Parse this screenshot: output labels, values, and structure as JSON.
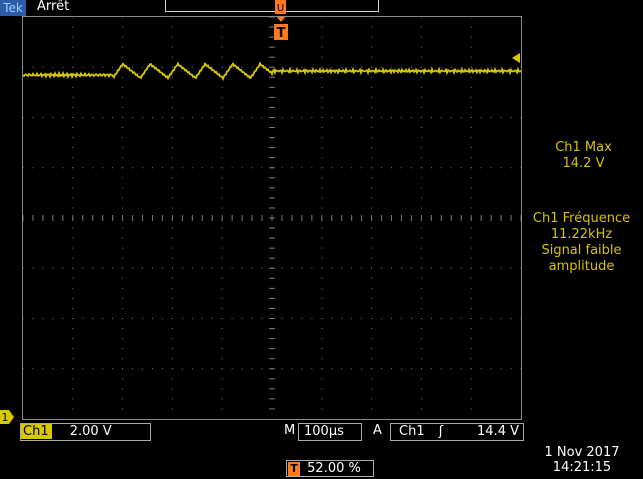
{
  "header": {
    "brand": "Tek",
    "acquisition_state": "Arrêt"
  },
  "measurements": {
    "max_label": "Ch1 Max",
    "max_value": "14.2 V",
    "freq_label": "Ch1 Fréquence",
    "freq_value": "11.22kHz",
    "freq_note_1": "Signal faible",
    "freq_note_2": "amplitude"
  },
  "status": {
    "channel": "Ch1",
    "volts_per_div": "2.00 V",
    "timebase_prefix": "M",
    "timebase": "100µs",
    "trigger_prefix": "A",
    "trigger_source": "Ch1",
    "trigger_slope": "ʃ",
    "trigger_level": "14.4 V",
    "trigger_position": "52.00 %",
    "date": "1 Nov 2017",
    "time": "14:21:15"
  },
  "markers": {
    "channel_marker": "1",
    "trigger_marker": "T"
  },
  "colors": {
    "trace": "#d6c800",
    "trigger": "#ff7a1a",
    "grid": "#7a7a7a"
  }
}
